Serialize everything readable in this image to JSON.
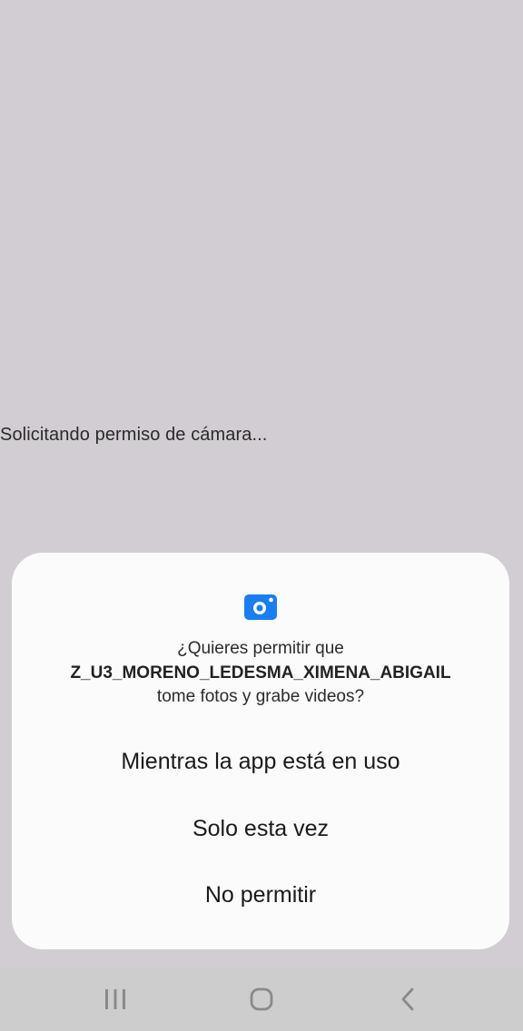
{
  "screen": {
    "status_text": "Solicitando permiso de cámara..."
  },
  "dialog": {
    "icon": "camera-icon",
    "prompt_line1": "¿Quieres permitir que",
    "app_name": "Z_U3_MORENO_LEDESMA_XIMENA_ABIGAIL",
    "prompt_line3": "tome fotos y grabe videos?",
    "options": [
      {
        "label": "Mientras la app está en uso"
      },
      {
        "label": "Solo esta vez"
      },
      {
        "label": "No permitir"
      }
    ]
  },
  "navbar": {
    "icons": [
      "recents-icon",
      "home-icon",
      "back-icon"
    ]
  },
  "colors": {
    "background": "#d2cdd2",
    "dialog": "#fbfbfb",
    "accent": "#1a7df0",
    "navbar": "#cdcdcd"
  }
}
